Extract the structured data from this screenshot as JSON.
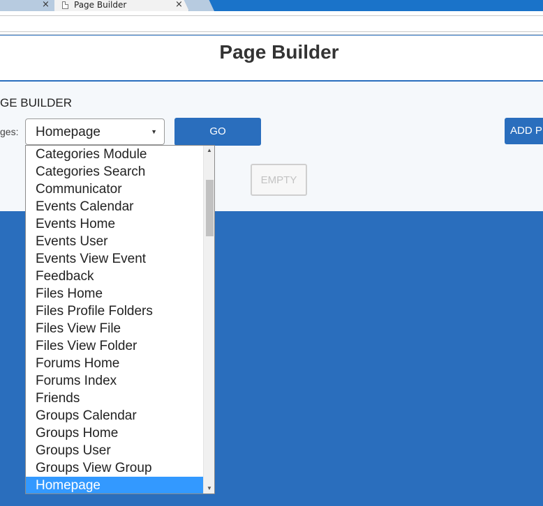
{
  "browser": {
    "tabs": [
      {
        "title": ""
      },
      {
        "title": "Page Builder"
      }
    ],
    "close_glyph": "×"
  },
  "page": {
    "title": "Page Builder",
    "section_heading": "GE BUILDER",
    "pages_label": "ges:"
  },
  "form": {
    "selected_page": "Homepage",
    "go_label": "GO",
    "add_label": "ADD P",
    "empty_label": "EMPTY"
  },
  "dropdown": {
    "options": [
      "Categories Module",
      "Categories Search",
      "Communicator",
      "Events Calendar",
      "Events Home",
      "Events User",
      "Events View Event",
      "Feedback",
      "Files Home",
      "Files Profile Folders",
      "Files View File",
      "Files View Folder",
      "Forums Home",
      "Forums Index",
      "Friends",
      "Groups Calendar",
      "Groups Home",
      "Groups User",
      "Groups View Group",
      "Homepage"
    ],
    "selected": "Homepage"
  },
  "colors": {
    "primary": "#2a6ebd",
    "selection": "#3399ff",
    "tab_bar": "#1a73c9"
  }
}
